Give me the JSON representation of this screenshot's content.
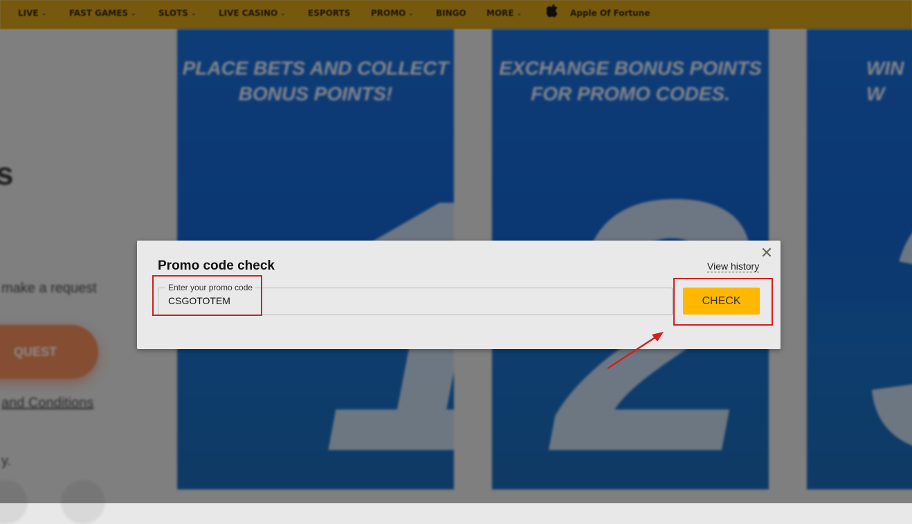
{
  "nav": {
    "items": [
      {
        "label": "LIVE",
        "dropdown": true
      },
      {
        "label": "FAST GAMES",
        "dropdown": true
      },
      {
        "label": "SLOTS",
        "dropdown": true
      },
      {
        "label": "LIVE CASINO",
        "dropdown": true
      },
      {
        "label": "ESPORTS",
        "dropdown": false
      },
      {
        "label": "PROMO",
        "dropdown": true
      },
      {
        "label": "BINGO",
        "dropdown": false
      },
      {
        "label": "MORE",
        "dropdown": true
      }
    ],
    "apple_label": "Apple Of Fortune",
    "color": "#d9a21a"
  },
  "background": {
    "heading_fragment": "s",
    "make_request_text": "make a request",
    "request_button_label": "QUEST",
    "terms_link": "and Conditions",
    "footer_fragment": "y.",
    "cards": [
      {
        "title_line1": "PLACE BETS AND COLLECT",
        "title_line2": "BONUS POINTS!",
        "number": "1"
      },
      {
        "title_line1": "EXCHANGE BONUS POINTS",
        "title_line2": "FOR PROMO CODES.",
        "number": "2"
      },
      {
        "title_line1": "WIN W",
        "title_line2": "",
        "number": "3"
      }
    ]
  },
  "modal": {
    "title": "Promo code check",
    "view_history": "View history",
    "close_symbol": "✕",
    "promo_field": {
      "label": "Enter your promo code",
      "value": "CSGOTOTEM"
    },
    "check_button": "CHECK",
    "accent_color": "#ffb700",
    "annotation_color": "#d11f1f"
  }
}
